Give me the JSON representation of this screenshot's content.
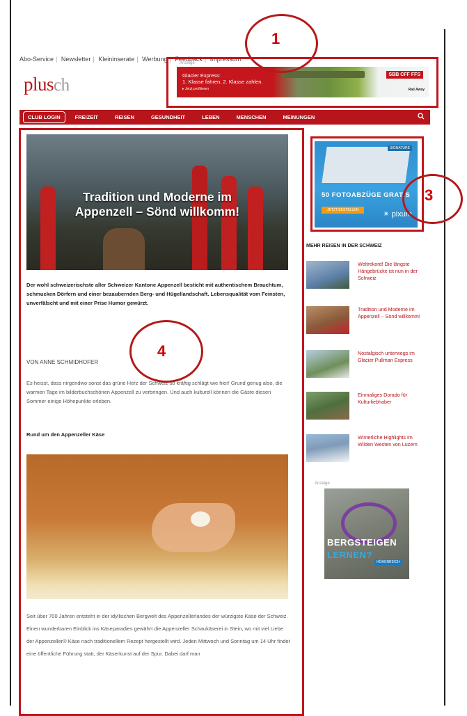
{
  "top_nav": [
    "Abo-Service",
    "Newsletter",
    "Kleininserate",
    "Werbung",
    "Feedback",
    "Impressum"
  ],
  "logo": {
    "brand": "plus",
    "suffix": "ch"
  },
  "ad_top": {
    "label": "Anzeige",
    "line1": "Glacier Express:",
    "line2": "1. Klasse fahren, 2. Klasse zahlen.",
    "line3": "▸ Jetzt profitieren",
    "sbb": "SBB CFF FFS",
    "rail": "Rail Away"
  },
  "main_nav": {
    "club_login": "CLUB LOGIN",
    "items": [
      "FREIZEIT",
      "REISEN",
      "GESUNDHEIT",
      "LEBEN",
      "MENSCHEN",
      "MEINUNGEN"
    ],
    "search_icon": "search-icon"
  },
  "article": {
    "title": "Tradition und Moderne im Appenzell – Sönd willkomm!",
    "lead": "Der wohl schweizerischste aller Schweizer Kantone Appenzell besticht mit authentischem Brauchtum, schmucken Dörfern und einer bezaubernden Berg- und Hügellandschaft. Lebensqualität vom Feinsten, unverfälscht und mit einer Prise Humor gewürzt.",
    "author": "VON ANNE SCHMIDHOFER",
    "body1": "Es heisst, dass nirgendwo sonst das grüne Herz der Schweiz so kräftig schlägt wie hier! Grund genug also, die warmen Tage im bilderbuchschönen Appenzell zu verbringen. Und auch kulturell können die Gäste diesen Sommer einige Höhepunkte erleben.",
    "subhead": "Rund um den Appenzeller Käse",
    "body2": "Seit über 700 Jahren entsteht in der idyllischen Bergwelt des Appenzellerlandes der würzigste Käse der Schweiz. Einen wunderbaren Einblick ins Käseparadies gewährt die Appenzeller Schaukäserei in Stein, wo mit viel Liebe der Appenzeller® Käse nach traditionellem Rezept hergestellt wird. Jeden Mittwoch und Sonntag um 14 Uhr findet eine öffentliche Führung statt, der Käserkunst auf der Spur. Dabei darf man"
  },
  "ad_side": {
    "pill": "SIGNATURE",
    "title": "50 FOTOABZÜGE GRATIS",
    "cta": "JETZT BESTELLEN",
    "brand": "✴ pixum"
  },
  "sidebar": {
    "heading": "MEHR REISEN IN DER SCHWEIZ",
    "items": [
      {
        "text": "Weltrekord! Die längste Hängebrücke ist nun in der Schweiz",
        "color": "#5d7fa6"
      },
      {
        "text": "Tradition und Moderne im Appenzell – Sönd willkomm!",
        "color": "#8a5a3a"
      },
      {
        "text": "Nostalgisch unterwegs im Glacier Pullman Express",
        "color": "#6f8f5a"
      },
      {
        "text": "Einmaliges Dorado für Kulturliebhaber",
        "color": "#4f6f3f"
      },
      {
        "text": "Winterliche Highlights im Wilden Westen von Luzern",
        "color": "#7f9bb8"
      }
    ]
  },
  "ad_climb": {
    "label": "Anzeige",
    "line1": "BERGSTEIGEN",
    "line2": "LERNEN?",
    "badge": "HÖHENREICH"
  },
  "annotations": [
    "1",
    "3",
    "4"
  ]
}
